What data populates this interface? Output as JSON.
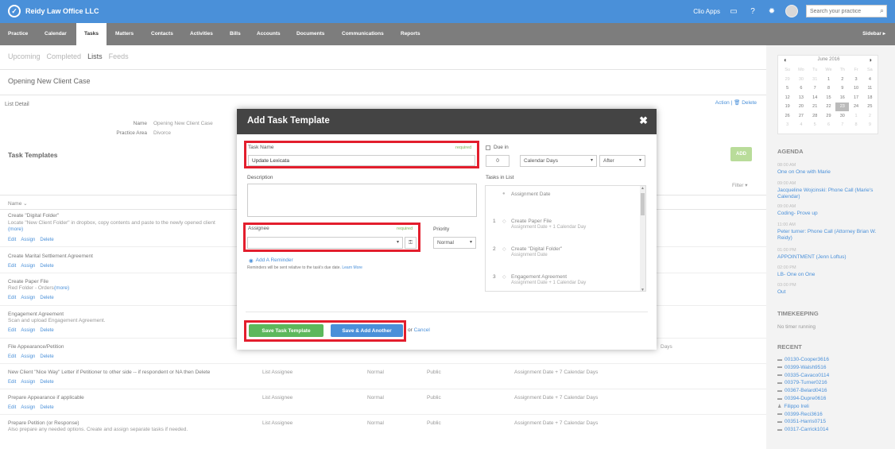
{
  "topbar": {
    "brand": "Reidy Law Office LLC",
    "apps_label": "Clio Apps",
    "search_placeholder": "Search your practice"
  },
  "nav": {
    "items": [
      "Practice",
      "Calendar",
      "Tasks",
      "Matters",
      "Contacts",
      "Activities",
      "Bills",
      "Accounts",
      "Documents",
      "Communications",
      "Reports"
    ],
    "active": "Tasks",
    "sidebar_toggle": "Sidebar ▸"
  },
  "subtabs": [
    "Upcoming",
    "Completed",
    "Lists",
    "Feeds"
  ],
  "page": {
    "title": "Opening New Client Case",
    "list_detail": "List Detail",
    "action_label": "Action",
    "delete_label": "Delete",
    "name_label": "Name",
    "name_value": "Opening New Client Case",
    "area_label": "Practice Area",
    "area_value": "Divorce",
    "templates_title": "Task Templates",
    "add_label": "ADD",
    "filter_label": "Filter ▾",
    "col_name": "Name ⌄"
  },
  "rows": [
    {
      "name": "Create \"Digital Folder\"",
      "desc": "Locate \"New Client Folder\" in dropbox, copy contents and paste to the newly opened client",
      "more": "(more)",
      "assignee": "",
      "priority": "",
      "privacy": "",
      "due": ""
    },
    {
      "name": "Create Marital Settlement Agreement",
      "desc": "",
      "more": "",
      "assignee": "",
      "priority": "",
      "privacy": "",
      "due": ""
    },
    {
      "name": "Create Paper File",
      "desc": "Red Folder - Orders",
      "more": "(more)",
      "assignee": "",
      "priority": "",
      "privacy": "",
      "due": ""
    },
    {
      "name": "Engagement Agreement",
      "desc": "Scan and upload Engagement Agreement.",
      "more": "",
      "assignee": "",
      "priority": "",
      "privacy": "",
      "due": ""
    },
    {
      "name": "File Appearance/Petition",
      "desc": "",
      "more": "",
      "assignee": "",
      "priority": "",
      "privacy": "",
      "due": "Days"
    },
    {
      "name": "New Client \"Nice Way\" Letter if Petitioner to other side -- if respondent or NA then Delete",
      "desc": "",
      "more": "",
      "assignee": "List Assignee",
      "priority": "Normal",
      "privacy": "Public",
      "due": "Assignment Date + 7 Calendar Days"
    },
    {
      "name": "Prepare Appearance if applicable",
      "desc": "",
      "more": "",
      "assignee": "List Assignee",
      "priority": "Normal",
      "privacy": "Public",
      "due": "Assignment Date + 7 Calendar Days"
    },
    {
      "name": "Prepare Petition (or Response)",
      "desc": "Also prepare any needed options. Create and assign separate tasks if needed.",
      "more": "",
      "assignee": "List Assignee",
      "priority": "Normal",
      "privacy": "Public",
      "due": "Assignment Date + 7 Calendar Days"
    }
  ],
  "row_actions": {
    "edit": "Edit",
    "assign": "Assign",
    "delete": "Delete"
  },
  "sidebar": {
    "calendar": {
      "month": "June 2016",
      "weekdays": [
        "Su",
        "Mo",
        "Tu",
        "We",
        "Th",
        "Fr",
        "Sa"
      ],
      "days": [
        "29",
        "30",
        "31",
        "1",
        "2",
        "3",
        "4",
        "5",
        "6",
        "7",
        "8",
        "9",
        "10",
        "11",
        "12",
        "13",
        "14",
        "15",
        "16",
        "17",
        "18",
        "19",
        "20",
        "21",
        "22",
        "23",
        "24",
        "25",
        "26",
        "27",
        "28",
        "29",
        "30",
        "1",
        "2",
        "3",
        "4",
        "5",
        "6",
        "7",
        "8",
        "9"
      ],
      "today": "23"
    },
    "agenda_title": "AGENDA",
    "agenda": [
      {
        "time": "08:00 AM",
        "text": "One on One with Marie"
      },
      {
        "time": "09:00 AM",
        "text": "Jacqueline Wojcinski: Phone Call (Marie's Calendar)"
      },
      {
        "time": "09:00 AM",
        "text": "Coding- Prove up"
      },
      {
        "time": "11:00 AM",
        "text": "Peter turner: Phone Call (Attorney Brian W. Reidy)"
      },
      {
        "time": "01:00 PM",
        "text": "APPOINTMENT (Jenn Loftus)"
      },
      {
        "time": "02:00 PM",
        "text": "LB- One on One"
      },
      {
        "time": "03:00 PM",
        "text": "Out"
      }
    ],
    "timekeeping_title": "TIMEKEEPING",
    "timekeeping_text": "No timer running",
    "recent_title": "RECENT",
    "recent": [
      "00130-Cooper3616",
      "00399-Walsh9516",
      "00335-Cavaco0114",
      "00379-Turner0216",
      "00367-Belard0416",
      "00394-Dupre0616",
      "Filippo Ireli",
      "00399-Reci3616",
      "00351-Harris0715",
      "00317-Carrick1014"
    ]
  },
  "modal": {
    "title": "Add Task Template",
    "close": "✖",
    "task_name_label": "Task Name",
    "required": "required",
    "task_name_value": "Update Lexicata",
    "description_label": "Description",
    "assignee_label": "Assignee",
    "priority_label": "Priority",
    "priority_value": "Normal",
    "due_in_label": "Due in",
    "due_in_value": "0",
    "due_unit": "Calendar Days",
    "due_relation": "After",
    "reminder_link": "Add A Reminder",
    "reminder_note": "Reminders will be sent relative to the task's due date.",
    "learn_more": "Learn More",
    "tasks_in_list_label": "Tasks in List",
    "tasks": [
      {
        "num": "",
        "name": "Assignment Date",
        "sub": ""
      },
      {
        "num": "1",
        "name": "Create Paper File",
        "sub": "Assignment Date + 1 Calendar Day"
      },
      {
        "num": "2",
        "name": "Create \"Digital Folder\"",
        "sub": "Assignment Date"
      },
      {
        "num": "3",
        "name": "Engagement Agreement",
        "sub": "Assignment Date + 1 Calendar Day"
      }
    ],
    "save_label": "Save Task Template",
    "save_add_label": "Save & Add Another",
    "or_label": "or",
    "cancel_label": "Cancel"
  },
  "colors": {
    "topbar": "#4a90d9",
    "nav": "#7d7d7d",
    "modal_header": "#444444",
    "save_green": "#5cb85c",
    "save_add_blue": "#4a90d9",
    "highlight_red": "#e31e2d"
  }
}
